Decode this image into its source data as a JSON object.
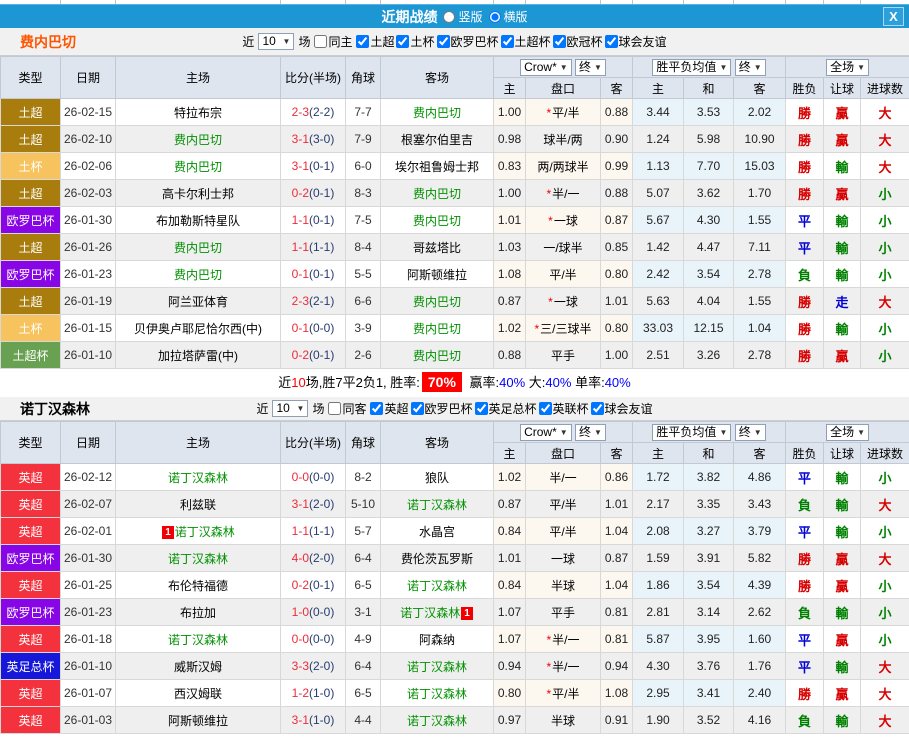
{
  "titlebar": {
    "title": "近期战绩",
    "radio_vertical": "竖版",
    "radio_horizontal": "横版",
    "close": "X"
  },
  "columns": {
    "type": "类型",
    "date": "日期",
    "home": "主场",
    "score": "比分(半场)",
    "corner": "角球",
    "away": "客场",
    "odds_select": "Crow*",
    "final_select": "终",
    "odds_sub": [
      "主",
      "盘口",
      "客"
    ],
    "mean_select": "胜平负均值",
    "mean_sub": [
      "主",
      "和",
      "客"
    ],
    "full_select": "全场",
    "result_sub": [
      "胜负",
      "让球",
      "进球数"
    ]
  },
  "league_colors": {
    "土超": "#a87d0e",
    "土杯": "#f6c35e",
    "欧罗巴杯": "#8805e5",
    "土超杯": "#69a152",
    "英超": "#f4323e",
    "英足总杯": "#1717d9"
  },
  "result_colors": {
    "勝": "c-r",
    "平": "c-b",
    "負": "c-g",
    "贏": "c-r",
    "輸": "c-g",
    "走": "c-b",
    "大": "c-r",
    "小": "c-g"
  },
  "sections": [
    {
      "team": "费内巴切",
      "team_color": "#ff5500",
      "filter": {
        "near": "近",
        "num": "10",
        "unit": "场",
        "same_label": "同主",
        "same_checked": false,
        "leagues": [
          "土超",
          "土杯",
          "欧罗巴杯",
          "土超杯",
          "欧冠杯",
          "球会友谊"
        ]
      },
      "rows": [
        {
          "type": "土超",
          "date": "26-02-15",
          "home": "特拉布宗",
          "hf": false,
          "hc": "",
          "score": "2-3",
          "half": "(2-2)",
          "corner": "7-7",
          "away": "费内巴切",
          "af": true,
          "ac": "",
          "o1": "1.00",
          "star": true,
          "hcap": "平/半",
          "o2": "0.88",
          "m1": "3.44",
          "m2": "3.53",
          "m3": "2.02",
          "r1": "勝",
          "r2": "贏",
          "r3": "大"
        },
        {
          "type": "土超",
          "date": "26-02-10",
          "home": "费内巴切",
          "hf": true,
          "hc": "",
          "score": "3-1",
          "half": "(3-0)",
          "corner": "7-9",
          "away": "根塞尔伯里吉",
          "af": false,
          "ac": "",
          "o1": "0.98",
          "star": false,
          "hcap": "球半/两",
          "o2": "0.90",
          "m1": "1.24",
          "m2": "5.98",
          "m3": "10.90",
          "r1": "勝",
          "r2": "贏",
          "r3": "大"
        },
        {
          "type": "土杯",
          "date": "26-02-06",
          "home": "费内巴切",
          "hf": true,
          "hc": "",
          "score": "3-1",
          "half": "(0-1)",
          "corner": "6-0",
          "away": "埃尔祖鲁姆士邦",
          "af": false,
          "ac": "",
          "o1": "0.83",
          "star": false,
          "hcap": "两/两球半",
          "o2": "0.99",
          "m1": "1.13",
          "m2": "7.70",
          "m3": "15.03",
          "r1": "勝",
          "r2": "輸",
          "r3": "大"
        },
        {
          "type": "土超",
          "date": "26-02-03",
          "home": "高卡尔利士邦",
          "hf": false,
          "hc": "",
          "score": "0-2",
          "half": "(0-1)",
          "corner": "8-3",
          "away": "费内巴切",
          "af": true,
          "ac": "",
          "o1": "1.00",
          "star": true,
          "hcap": "半/一",
          "o2": "0.88",
          "m1": "5.07",
          "m2": "3.62",
          "m3": "1.70",
          "r1": "勝",
          "r2": "贏",
          "r3": "小"
        },
        {
          "type": "欧罗巴杯",
          "date": "26-01-30",
          "home": "布加勒斯特星队",
          "hf": false,
          "hc": "",
          "score": "1-1",
          "half": "(0-1)",
          "corner": "7-5",
          "away": "费内巴切",
          "af": true,
          "ac": "",
          "o1": "1.01",
          "star": true,
          "hcap": "一球",
          "o2": "0.87",
          "m1": "5.67",
          "m2": "4.30",
          "m3": "1.55",
          "r1": "平",
          "r2": "輸",
          "r3": "小"
        },
        {
          "type": "土超",
          "date": "26-01-26",
          "home": "费内巴切",
          "hf": true,
          "hc": "",
          "score": "1-1",
          "half": "(1-1)",
          "corner": "8-4",
          "away": "哥兹塔比",
          "af": false,
          "ac": "",
          "o1": "1.03",
          "star": false,
          "hcap": "一/球半",
          "o2": "0.85",
          "m1": "1.42",
          "m2": "4.47",
          "m3": "7.11",
          "r1": "平",
          "r2": "輸",
          "r3": "小"
        },
        {
          "type": "欧罗巴杯",
          "date": "26-01-23",
          "home": "费内巴切",
          "hf": true,
          "hc": "",
          "score": "0-1",
          "half": "(0-1)",
          "corner": "5-5",
          "away": "阿斯顿维拉",
          "af": false,
          "ac": "",
          "o1": "1.08",
          "star": false,
          "hcap": "平/半",
          "o2": "0.80",
          "m1": "2.42",
          "m2": "3.54",
          "m3": "2.78",
          "r1": "負",
          "r2": "輸",
          "r3": "小"
        },
        {
          "type": "土超",
          "date": "26-01-19",
          "home": "阿兰亚体育",
          "hf": false,
          "hc": "",
          "score": "2-3",
          "half": "(2-1)",
          "corner": "6-6",
          "away": "费内巴切",
          "af": true,
          "ac": "",
          "o1": "0.87",
          "star": true,
          "hcap": "一球",
          "o2": "1.01",
          "m1": "5.63",
          "m2": "4.04",
          "m3": "1.55",
          "r1": "勝",
          "r2": "走",
          "r3": "大"
        },
        {
          "type": "土杯",
          "date": "26-01-15",
          "home": "贝伊奥卢耶尼恰尔西(中)",
          "hf": false,
          "hc": "",
          "score": "0-1",
          "half": "(0-0)",
          "corner": "3-9",
          "away": "费内巴切",
          "af": true,
          "ac": "",
          "o1": "1.02",
          "star": true,
          "hcap": "三/三球半",
          "o2": "0.80",
          "m1": "33.03",
          "m2": "12.15",
          "m3": "1.04",
          "r1": "勝",
          "r2": "輸",
          "r3": "小"
        },
        {
          "type": "土超杯",
          "date": "26-01-10",
          "home": "加拉塔萨雷(中)",
          "hf": false,
          "hc": "",
          "score": "0-2",
          "half": "(0-1)",
          "corner": "2-6",
          "away": "费内巴切",
          "af": true,
          "ac": "",
          "o1": "0.88",
          "star": false,
          "hcap": "平手",
          "o2": "1.00",
          "m1": "2.51",
          "m2": "3.26",
          "m3": "2.78",
          "r1": "勝",
          "r2": "贏",
          "r3": "小"
        }
      ],
      "summary": {
        "prefix": "近",
        "count": "10",
        "mid": "场,胜7平2负1, 胜率:",
        "rate": "70%",
        "stats": [
          {
            "label": "赢率:",
            "value": "40%"
          },
          {
            "label": "大:",
            "value": "40%"
          },
          {
            "label": "单率:",
            "value": "40%"
          }
        ]
      }
    },
    {
      "team": "诺丁汉森林",
      "team_color": "#000000",
      "filter": {
        "near": "近",
        "num": "10",
        "unit": "场",
        "same_label": "同客",
        "same_checked": false,
        "leagues": [
          "英超",
          "欧罗巴杯",
          "英足总杯",
          "英联杯",
          "球会友谊"
        ]
      },
      "rows": [
        {
          "type": "英超",
          "date": "26-02-12",
          "home": "诺丁汉森林",
          "hf": true,
          "hc": "",
          "score": "0-0",
          "half": "(0-0)",
          "corner": "8-2",
          "away": "狼队",
          "af": false,
          "ac": "",
          "o1": "1.02",
          "star": false,
          "hcap": "半/一",
          "o2": "0.86",
          "m1": "1.72",
          "m2": "3.82",
          "m3": "4.86",
          "r1": "平",
          "r2": "輸",
          "r3": "小"
        },
        {
          "type": "英超",
          "date": "26-02-07",
          "home": "利兹联",
          "hf": false,
          "hc": "",
          "score": "3-1",
          "half": "(2-0)",
          "corner": "5-10",
          "away": "诺丁汉森林",
          "af": true,
          "ac": "",
          "o1": "0.87",
          "star": false,
          "hcap": "平/半",
          "o2": "1.01",
          "m1": "2.17",
          "m2": "3.35",
          "m3": "3.43",
          "r1": "負",
          "r2": "輸",
          "r3": "大"
        },
        {
          "type": "英超",
          "date": "26-02-01",
          "home": "诺丁汉森林",
          "hf": true,
          "hc": "1",
          "score": "1-1",
          "half": "(1-1)",
          "corner": "5-7",
          "away": "水晶宫",
          "af": false,
          "ac": "",
          "o1": "0.84",
          "star": false,
          "hcap": "平/半",
          "o2": "1.04",
          "m1": "2.08",
          "m2": "3.27",
          "m3": "3.79",
          "r1": "平",
          "r2": "輸",
          "r3": "小"
        },
        {
          "type": "欧罗巴杯",
          "date": "26-01-30",
          "home": "诺丁汉森林",
          "hf": true,
          "hc": "",
          "score": "4-0",
          "half": "(2-0)",
          "corner": "6-4",
          "away": "费伦茨瓦罗斯",
          "af": false,
          "ac": "",
          "o1": "1.01",
          "star": false,
          "hcap": "一球",
          "o2": "0.87",
          "m1": "1.59",
          "m2": "3.91",
          "m3": "5.82",
          "r1": "勝",
          "r2": "贏",
          "r3": "大"
        },
        {
          "type": "英超",
          "date": "26-01-25",
          "home": "布伦特福德",
          "hf": false,
          "hc": "",
          "score": "0-2",
          "half": "(0-1)",
          "corner": "6-5",
          "away": "诺丁汉森林",
          "af": true,
          "ac": "",
          "o1": "0.84",
          "star": false,
          "hcap": "半球",
          "o2": "1.04",
          "m1": "1.86",
          "m2": "3.54",
          "m3": "4.39",
          "r1": "勝",
          "r2": "贏",
          "r3": "小"
        },
        {
          "type": "欧罗巴杯",
          "date": "26-01-23",
          "home": "布拉加",
          "hf": false,
          "hc": "",
          "score": "1-0",
          "half": "(0-0)",
          "corner": "3-1",
          "away": "诺丁汉森林",
          "af": true,
          "ac": "1",
          "o1": "1.07",
          "star": false,
          "hcap": "平手",
          "o2": "0.81",
          "m1": "2.81",
          "m2": "3.14",
          "m3": "2.62",
          "r1": "負",
          "r2": "輸",
          "r3": "小"
        },
        {
          "type": "英超",
          "date": "26-01-18",
          "home": "诺丁汉森林",
          "hf": true,
          "hc": "",
          "score": "0-0",
          "half": "(0-0)",
          "corner": "4-9",
          "away": "阿森纳",
          "af": false,
          "ac": "",
          "o1": "1.07",
          "star": true,
          "hcap": "半/一",
          "o2": "0.81",
          "m1": "5.87",
          "m2": "3.95",
          "m3": "1.60",
          "r1": "平",
          "r2": "贏",
          "r3": "小"
        },
        {
          "type": "英足总杯",
          "date": "26-01-10",
          "home": "威斯汉姆",
          "hf": false,
          "hc": "",
          "score": "3-3",
          "half": "(2-0)",
          "corner": "6-4",
          "away": "诺丁汉森林",
          "af": true,
          "ac": "",
          "o1": "0.94",
          "star": true,
          "hcap": "半/一",
          "o2": "0.94",
          "m1": "4.30",
          "m2": "3.76",
          "m3": "1.76",
          "r1": "平",
          "r2": "輸",
          "r3": "大"
        },
        {
          "type": "英超",
          "date": "26-01-07",
          "home": "西汉姆联",
          "hf": false,
          "hc": "",
          "score": "1-2",
          "half": "(1-0)",
          "corner": "6-5",
          "away": "诺丁汉森林",
          "af": true,
          "ac": "",
          "o1": "0.80",
          "star": true,
          "hcap": "平/半",
          "o2": "1.08",
          "m1": "2.95",
          "m2": "3.41",
          "m3": "2.40",
          "r1": "勝",
          "r2": "贏",
          "r3": "大"
        },
        {
          "type": "英超",
          "date": "26-01-03",
          "home": "阿斯顿维拉",
          "hf": false,
          "hc": "",
          "score": "3-1",
          "half": "(1-0)",
          "corner": "4-4",
          "away": "诺丁汉森林",
          "af": true,
          "ac": "",
          "o1": "0.97",
          "star": false,
          "hcap": "半球",
          "o2": "0.91",
          "m1": "1.90",
          "m2": "3.52",
          "m3": "4.16",
          "r1": "負",
          "r2": "輸",
          "r3": "大"
        }
      ]
    }
  ]
}
